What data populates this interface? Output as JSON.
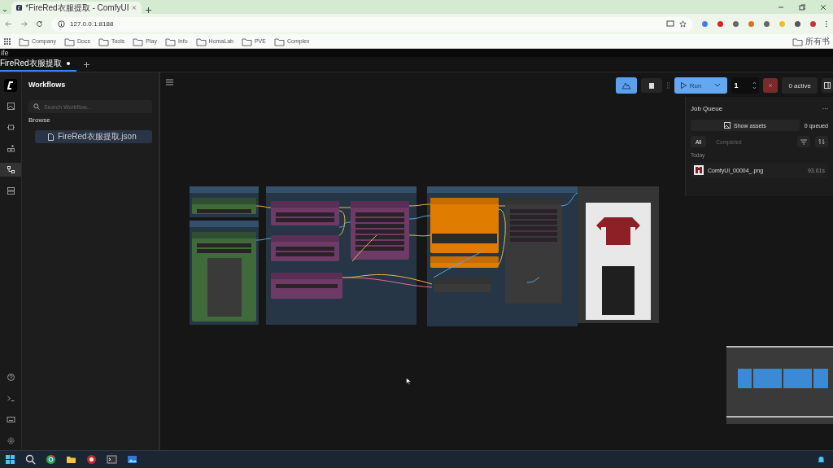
{
  "browser": {
    "tab_title": "*FireRed衣服提取 - ComfyUI",
    "url": "127.0.0.1:8188",
    "bookmarks": [
      "Company",
      "Docs",
      "Tools",
      "Play",
      "Info",
      "HomaLab",
      "PVE",
      "Complex"
    ],
    "all_bookmarks": "所有书"
  },
  "app": {
    "title_strip": "ife",
    "tabs": [
      {
        "label": "FireRed衣服提取",
        "modified": true,
        "selected": true
      }
    ],
    "rail_items": [
      {
        "selected": false
      },
      {
        "selected": false
      },
      {
        "selected": false
      },
      {
        "selected": true
      },
      {
        "selected": false
      }
    ],
    "sidebar": {
      "title": "Workflows",
      "search": {
        "placeholder": "Search Workflow..."
      },
      "section": "Browse",
      "files": [
        {
          "name": "FireRed衣服提取.json",
          "selected": true
        }
      ]
    },
    "toolbar": {
      "run": "Run",
      "batch_count": "1",
      "active": "0 active"
    },
    "job_queue": {
      "title": "Job Queue",
      "show_assets": "Show assets",
      "queued": "0 queued",
      "filters": [
        {
          "label": "All",
          "selected": true
        },
        {
          "label": "Completed",
          "selected": false
        }
      ],
      "group": "Today",
      "items": [
        {
          "name": "ComfyUI_00004_.png",
          "time": "93.61s"
        }
      ]
    }
  }
}
